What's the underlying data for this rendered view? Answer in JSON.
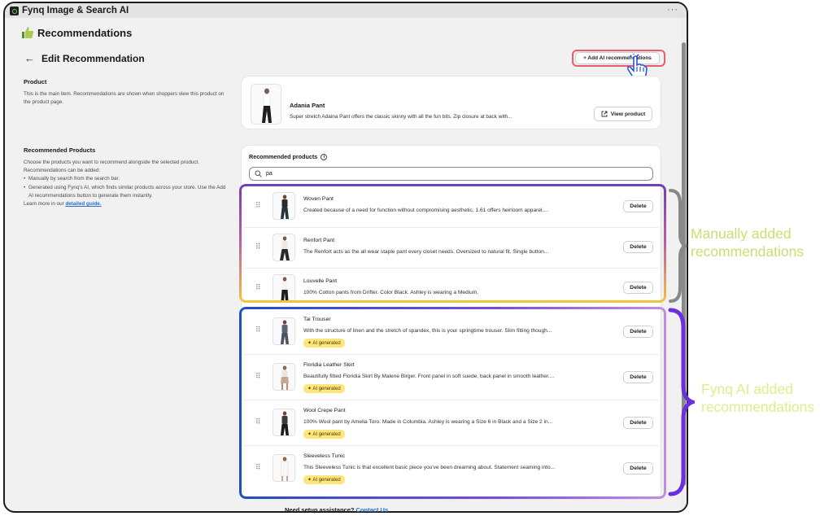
{
  "app": {
    "title": "Fynq Image & Search AI",
    "menu_dots": "···"
  },
  "page": {
    "heading": "Recommendations",
    "back_arrow": "←",
    "edit_title": "Edit Recommendation",
    "ai_button_label": "+ Add AI recommendations"
  },
  "product_section": {
    "title": "Product",
    "description": "This is the main item. Recommendations are shown when shoppers view this product on the product page.",
    "product": {
      "name": "Adania Pant",
      "description": "Super stretch Adaina Pant offers the classic skinny with all the fun bits. Zip closure at back with...",
      "view_button": "View product"
    }
  },
  "recommended_section": {
    "title": "Recommended Products",
    "intro": "Choose the products you want to recommend alongside the selected product. Recommendations can be added:",
    "bullets": [
      "Manually by search from the search bar.",
      "Generated using Fynq's AI, which finds similar products across your store. Use the Add AI recommendations button to generate them instantly."
    ],
    "learn_more_prefix": "Learn more in our ",
    "learn_more_link": "detailed guide.",
    "label": "Recommended products",
    "search_value": "pa"
  },
  "manual_items": [
    {
      "name": "Woven Pant",
      "description": "Created because of a need for function without compromising aesthetic, 1.61 offers heirloom apparel....",
      "delete": "Delete"
    },
    {
      "name": "Renfort Pant",
      "description": "The Renfort acts as the all wear staple pant every closet needs. Oversized to natural fit. Single button...",
      "delete": "Delete"
    },
    {
      "name": "Louvelle Pant",
      "description": "100% Cotton pants from Drifter. Color Black. Ashley is wearing a Medium.",
      "delete": "Delete"
    }
  ],
  "ai_items": [
    {
      "name": "Tai Trouser",
      "description": "With the structure of linen and the stretch of spandex, this is your springtime trouser. Slim fitting though...",
      "badge": "✦ AI generated",
      "delete": "Delete"
    },
    {
      "name": "Floridia Leather Skirt",
      "description": "Beautifully fitted Floridia Skirt By Malene Birger. Front panel in soft suede, back panel in smooth leather....",
      "badge": "✦ AI generated",
      "delete": "Delete"
    },
    {
      "name": "Wool Crepe Pant",
      "description": "100% Wool pant by Amelia Toro. Made in Columbia. Ashley is wearing a Size 6 in Black and a Size 2 in...",
      "badge": "✦ AI generated",
      "delete": "Delete"
    },
    {
      "name": "Sleeveless Tunic",
      "description": "This Sleeveless Tunic is that excellent basic piece you've been dreaming about. Statement seaming into...",
      "badge": "✦ AI generated",
      "delete": "Delete"
    }
  ],
  "footer": {
    "text": "Need setup assistance? ",
    "link": "Contact Us"
  },
  "annotations": {
    "manual_line1": "Manually added",
    "manual_line2": "recommendations",
    "ai_line1": "Fynq AI added",
    "ai_line2": "recommendations"
  },
  "colors": {
    "manual_border_top": "#6f3fb3",
    "manual_border_bottom": "#f2c63a",
    "ai_border": "#1f4fbf",
    "ai_highlight": "#ec5c6d",
    "ai_badge": "#ffe67a",
    "link": "#2c6ecb"
  },
  "icons": [
    "thumbs-up-icon",
    "back-arrow-icon",
    "info-icon",
    "search-icon",
    "external-link-icon",
    "drag-handle-icon",
    "pointer-hand-icon"
  ]
}
